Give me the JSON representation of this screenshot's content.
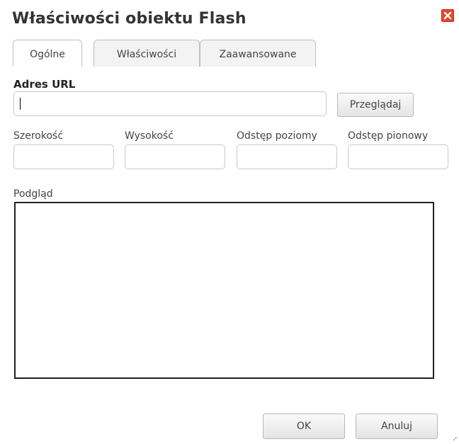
{
  "dialog": {
    "title": "Właściwości obiektu Flash",
    "close_icon": "close-x-icon",
    "close_color": "#e6492f"
  },
  "tabs": [
    {
      "label": "Ogólne",
      "active": true
    },
    {
      "label": "Właściwości",
      "active": false
    },
    {
      "label": "Zaawansowane",
      "active": false
    }
  ],
  "url": {
    "label": "Adres URL",
    "value": "",
    "browse_label": "Przeglądaj"
  },
  "dimensions": {
    "width_label": "Szerokość",
    "height_label": "Wysokość",
    "hspace_label": "Odstęp poziomy",
    "vspace_label": "Odstęp pionowy",
    "width_value": "",
    "height_value": "",
    "hspace_value": "",
    "vspace_value": ""
  },
  "preview": {
    "label": "Podgląd"
  },
  "footer": {
    "ok_label": "OK",
    "cancel_label": "Anuluj"
  }
}
